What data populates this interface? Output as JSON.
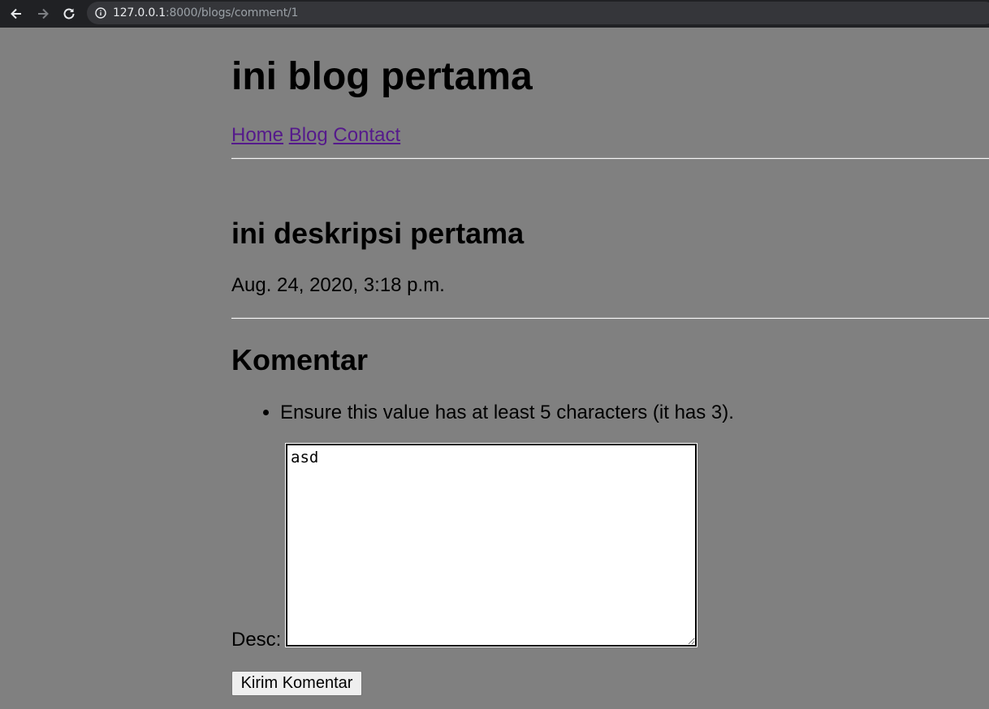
{
  "browser": {
    "url_host": "127.0.0.1",
    "url_path": ":8000/blogs/comment/1"
  },
  "site": {
    "title": "ini blog pertama",
    "nav": [
      "Home",
      "Blog",
      "Contact"
    ]
  },
  "post": {
    "title": "ini deskripsi pertama",
    "date": "Aug. 24, 2020, 3:18 p.m."
  },
  "comments": {
    "heading": "Komentar",
    "errors": [
      "Ensure this value has at least 5 characters (it has 3)."
    ],
    "desc_label": "Desc:",
    "desc_value": "asd",
    "submit_label": "Kirim Komentar"
  }
}
